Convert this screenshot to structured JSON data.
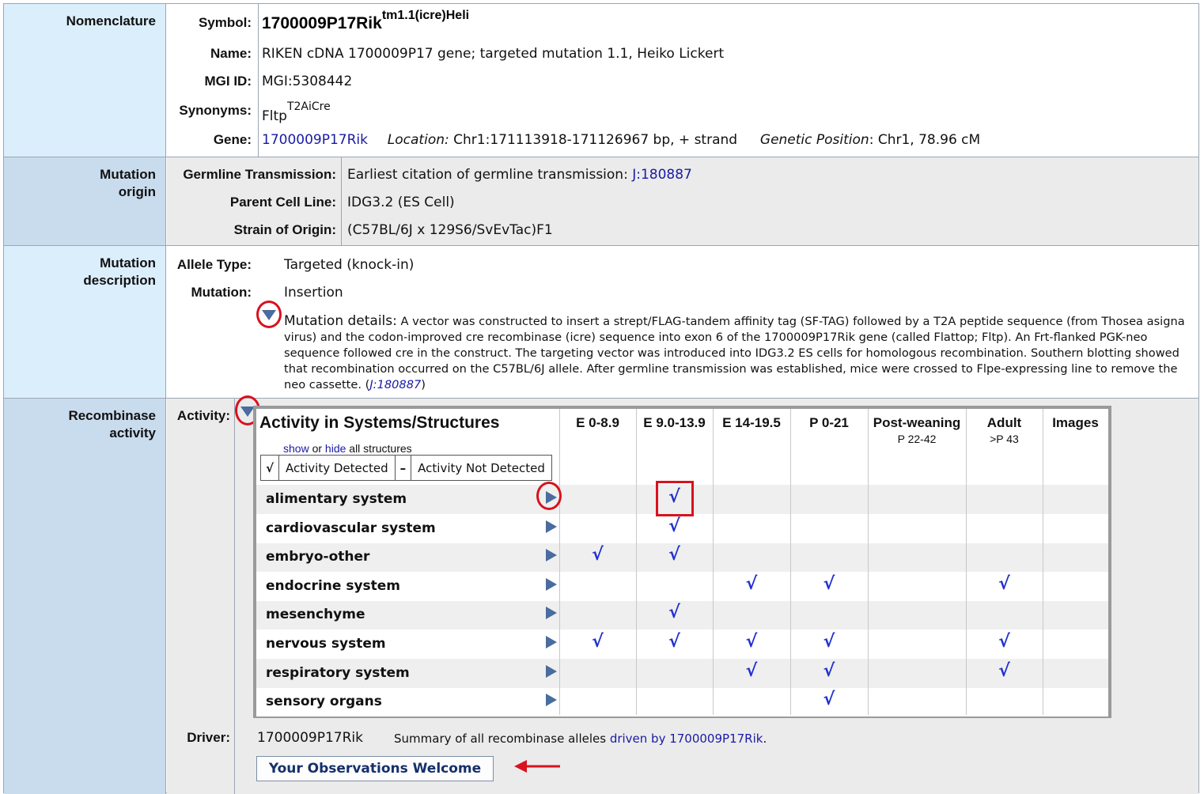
{
  "nomenclature": {
    "section_label": "Nomenclature",
    "symbol_label": "Symbol:",
    "symbol_base": "1700009P17Rik",
    "symbol_sup": "tm1.1(icre)Heli",
    "name_label": "Name:",
    "name_value": "RIKEN cDNA 1700009P17 gene; targeted mutation 1.1, Heiko Lickert",
    "mgi_label": "MGI ID:",
    "mgi_value": "MGI:5308442",
    "synonyms_label": "Synonyms:",
    "synonym_base": "Fltp",
    "synonym_sup": "T2AiCre",
    "gene_label": "Gene:",
    "gene_link": "1700009P17Rik",
    "location_label": "Location:",
    "location_value": "Chr1:171113918-171126967 bp, + strand",
    "genetic_position_label": "Genetic Position",
    "genetic_position_value": ": Chr1, 78.96 cM"
  },
  "mutation_origin": {
    "section_label_1": "Mutation",
    "section_label_2": "origin",
    "germline_label": "Germline Transmission:",
    "germline_text": "Earliest citation of germline transmission: ",
    "germline_link": "J:180887",
    "parent_label": "Parent Cell Line:",
    "parent_value": "IDG3.2 (ES Cell)",
    "strain_label": "Strain of Origin:",
    "strain_value": "(C57BL/6J x 129S6/SvEvTac)F1"
  },
  "mutation_description": {
    "section_label_1": "Mutation",
    "section_label_2": "description",
    "allele_type_label": "Allele Type:",
    "allele_type_value": "Targeted (knock-in)",
    "mutation_label": "Mutation:",
    "mutation_value": "Insertion",
    "details_lead": "Mutation details:",
    "details_text": " A vector was constructed to insert a strept/FLAG-tandem affinity tag (SF-TAG) followed by a T2A peptide sequence (from Thosea asigna virus) and the codon-improved cre recombinase (icre) sequence into exon 6 of the 1700009P17Rik gene (called Flattop; Fltp). An Frt-flanked PGK-neo sequence followed cre in the construct. The targeting vector was introduced into IDG3.2 ES cells for homologous recombination. Southern blotting showed that recombination occurred on the C57BL/6J allele. After germline transmission was established, mice were crossed to Flpe-expressing line to remove the neo cassette. (",
    "details_link": "J:180887",
    "details_close": ")"
  },
  "recombinase": {
    "section_label_1": "Recombinase",
    "section_label_2": "activity",
    "activity_label": "Activity:",
    "grid_title": "Activity in Systems/Structures",
    "show_link": "show",
    "or_text": " or ",
    "hide_link": "hide",
    "all_structures_text": " all structures",
    "legend_detected_symbol": "√",
    "legend_detected": "Activity Detected",
    "legend_not_symbol": "–",
    "legend_not": "Activity Not Detected",
    "columns": [
      {
        "head": "E 0-8.9",
        "sub": ""
      },
      {
        "head": "E 9.0-13.9",
        "sub": ""
      },
      {
        "head": "E 14-19.5",
        "sub": ""
      },
      {
        "head": "P 0-21",
        "sub": ""
      },
      {
        "head": "Post-weaning",
        "sub": "P 22-42"
      },
      {
        "head": "Adult",
        "sub": ">P 43"
      },
      {
        "head": "Images",
        "sub": ""
      }
    ],
    "check_symbol": "√",
    "rows": [
      {
        "label": "alimentary system",
        "checks": [
          false,
          true,
          false,
          false,
          false,
          false,
          false
        ]
      },
      {
        "label": "cardiovascular system",
        "checks": [
          false,
          true,
          false,
          false,
          false,
          false,
          false
        ]
      },
      {
        "label": "embryo-other",
        "checks": [
          true,
          true,
          false,
          false,
          false,
          false,
          false
        ]
      },
      {
        "label": "endocrine system",
        "checks": [
          false,
          false,
          true,
          true,
          false,
          true,
          false
        ]
      },
      {
        "label": "mesenchyme",
        "checks": [
          false,
          true,
          false,
          false,
          false,
          false,
          false
        ]
      },
      {
        "label": "nervous system",
        "checks": [
          true,
          true,
          true,
          true,
          false,
          true,
          false
        ]
      },
      {
        "label": "respiratory system",
        "checks": [
          false,
          false,
          true,
          true,
          false,
          true,
          false
        ]
      },
      {
        "label": "sensory organs",
        "checks": [
          false,
          false,
          false,
          true,
          false,
          false,
          false
        ]
      }
    ],
    "driver_label": "Driver:",
    "driver_value": "1700009P17Rik",
    "summary_text": "Summary of all recombinase alleles ",
    "summary_link": "driven by 1700009P17Rik",
    "summary_end": ".",
    "observations_button": "Your Observations Welcome"
  },
  "colors": {
    "link": "#1a1aa6",
    "check": "#1f2fd0",
    "annotation_red": "#d8121e",
    "toggle_blue": "#4a6c9e"
  }
}
